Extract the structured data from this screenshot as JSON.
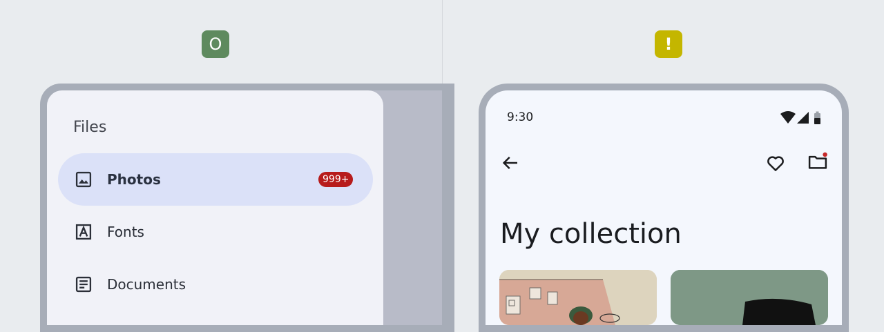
{
  "markers": {
    "good": "O",
    "warn": "!"
  },
  "drawer": {
    "title": "Files",
    "items": [
      {
        "label": "Photos",
        "icon": "image-icon",
        "badge": "999+",
        "active": true
      },
      {
        "label": "Fonts",
        "icon": "font-icon",
        "active": false
      },
      {
        "label": "Documents",
        "icon": "document-icon",
        "active": false
      }
    ]
  },
  "phone": {
    "status": {
      "time": "9:30"
    },
    "top_bar": {
      "back_icon": "arrow-back-icon",
      "favorite_icon": "heart-icon",
      "folder_icon": "folder-icon"
    },
    "headline": "My collection"
  },
  "colors": {
    "good_marker": "#5e8a5e",
    "warn_marker": "#c4b600",
    "active_item": "#dbe1f8",
    "badge": "#b71c1c"
  }
}
